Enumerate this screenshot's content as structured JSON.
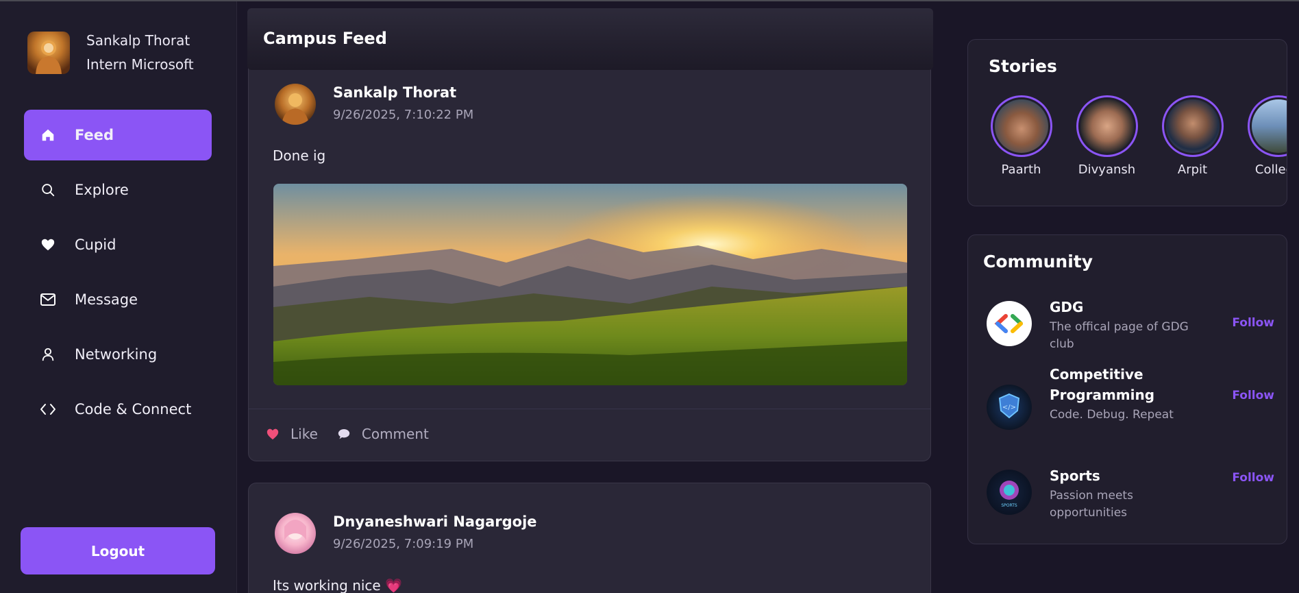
{
  "sidebar": {
    "profile": {
      "name": "Sankalp Thorat",
      "role": "Intern Microsoft"
    },
    "nav": [
      {
        "label": "Feed",
        "icon": "home-icon",
        "active": true
      },
      {
        "label": "Explore",
        "icon": "search-icon"
      },
      {
        "label": "Cupid",
        "icon": "heart-icon"
      },
      {
        "label": "Message",
        "icon": "mail-icon"
      },
      {
        "label": "Networking",
        "icon": "user-icon"
      },
      {
        "label": "Code & Connect",
        "icon": "code-icon"
      }
    ],
    "logout_label": "Logout"
  },
  "feed": {
    "title": "Campus Feed",
    "posts": [
      {
        "author": "Sankalp Thorat",
        "date": "9/26/2025, 7:10:22 PM",
        "text": "Done ig",
        "image": "mountain-sunset-image",
        "like_label": "Like",
        "comment_label": "Comment"
      },
      {
        "author": "Dnyaneshwari Nagargoje",
        "date": "9/26/2025, 7:09:19 PM",
        "text": "Its working nice 💗"
      }
    ]
  },
  "stories": {
    "title": "Stories",
    "items": [
      {
        "name": "Paarth"
      },
      {
        "name": "Divyansh"
      },
      {
        "name": "Arpit"
      },
      {
        "name": "College"
      }
    ]
  },
  "community": {
    "title": "Community",
    "follow_label": "Follow",
    "items": [
      {
        "name": "GDG",
        "desc": "The offical page of GDG club"
      },
      {
        "name": "Competitive Programming",
        "desc": "Code. Debug. Repeat"
      },
      {
        "name": "Sports",
        "desc": "Passion meets opportunities"
      }
    ]
  },
  "colors": {
    "accent": "#8b55f5",
    "background": "#1a1627",
    "card": "#2a2737",
    "like": "#f0507a"
  }
}
